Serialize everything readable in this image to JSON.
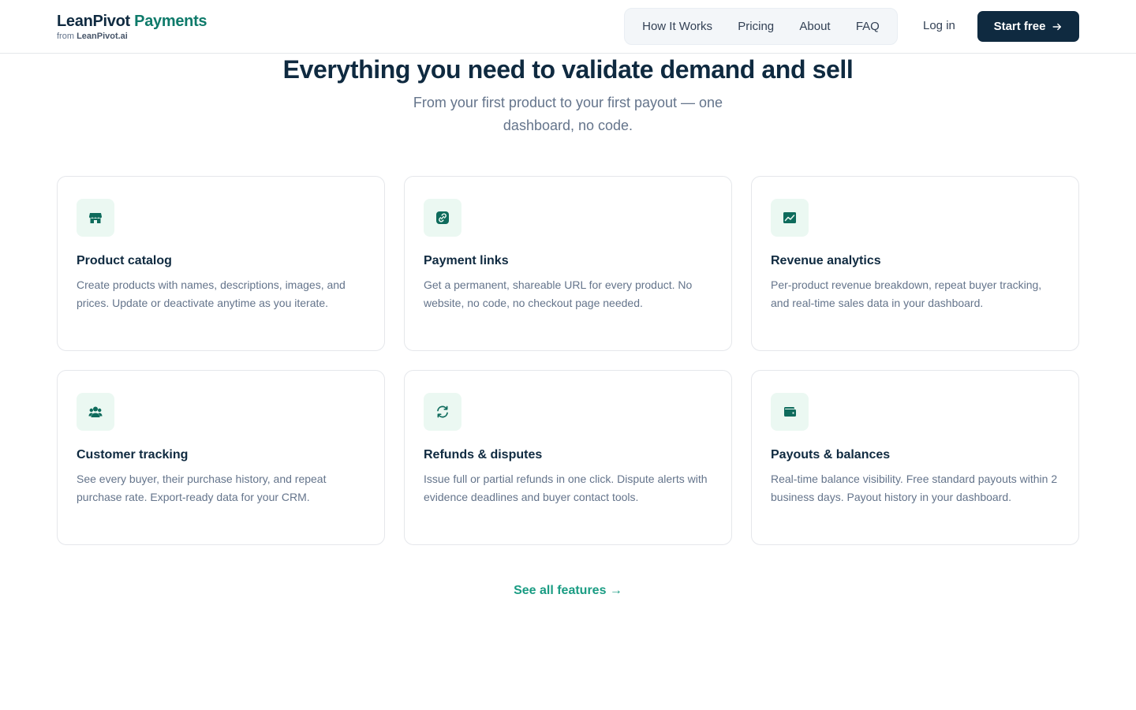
{
  "header": {
    "brand_name": "LeanPivot",
    "brand_accent": "Payments",
    "brand_from": "from",
    "brand_parent": "LeanPivot.ai",
    "nav": [
      "How It Works",
      "Pricing",
      "About",
      "FAQ"
    ],
    "login_label": "Log in",
    "cta_label": "Start free",
    "cta_icon": "arrow-right-icon"
  },
  "hero": {
    "title": "Everything you need to validate demand and sell",
    "subtitle": "From your first product to your first payout — one dashboard, no code."
  },
  "features": [
    {
      "icon": "store-icon",
      "title": "Product catalog",
      "description": "Create products with names, descriptions, images, and prices. Update or deactivate anytime as you iterate."
    },
    {
      "icon": "link-icon",
      "title": "Payment links",
      "description": "Get a permanent, shareable URL for every product. No website, no code, no checkout page needed."
    },
    {
      "icon": "chart-line-icon",
      "title": "Revenue analytics",
      "description": "Per-product revenue breakdown, repeat buyer tracking, and real-time sales data in your dashboard."
    },
    {
      "icon": "users-icon",
      "title": "Customer tracking",
      "description": "See every buyer, their purchase history, and repeat purchase rate. Export-ready data for your CRM."
    },
    {
      "icon": "refresh-icon",
      "title": "Refunds & disputes",
      "description": "Issue full or partial refunds in one click. Dispute alerts with evidence deadlines and buyer contact tools."
    },
    {
      "icon": "wallet-icon",
      "title": "Payouts & balances",
      "description": "Real-time balance visibility. Free standard payouts within 2 business days. Payout history in your dashboard."
    }
  ],
  "see_all_label": "See all features →",
  "colors": {
    "navy": "#0f2a40",
    "brand_green": "#0e7a6a",
    "icon_bg": "#ebf8f2",
    "link_teal": "#1a9c83"
  }
}
